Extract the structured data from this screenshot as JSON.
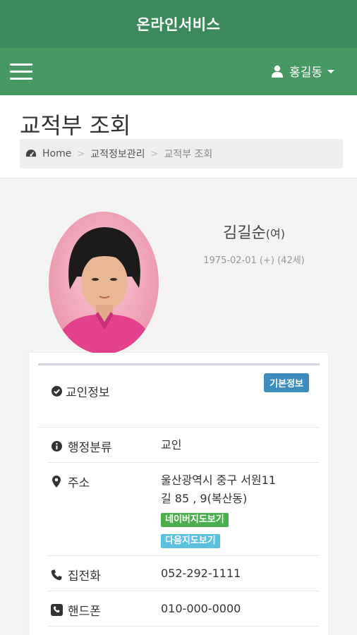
{
  "app": {
    "title": "온라인서비스"
  },
  "navbar": {
    "user_name": "홍길동"
  },
  "page": {
    "title": "교적부 조회",
    "breadcrumb": [
      "Home",
      "교적정보관리",
      "교적부 조회"
    ]
  },
  "profile": {
    "name": "김길순",
    "gender": "(여)",
    "birth": "1975-02-01 (+) (42세)"
  },
  "info_panel": {
    "title": "교인정보",
    "badge": "기본정보",
    "rows": {
      "category": {
        "label": "행정분류",
        "value": "교인"
      },
      "address": {
        "label": "주소",
        "line1": "울산광역시 중구 서원11",
        "line2": "길 85 , 9(복산동)",
        "naver_map": "네이버지도보기",
        "daum_map": "다음지도보기"
      },
      "home_phone": {
        "label": "집전화",
        "value": "052-292-1111"
      },
      "mobile": {
        "label": "핸드폰",
        "value": "010-000-0000"
      }
    }
  },
  "colors": {
    "header": "#3c8a5c",
    "navbar": "#489864",
    "badge": "#3c8dbc",
    "naver_button": "#4cae4c",
    "daum_button": "#5bc0de"
  },
  "icons": {
    "menu": "hamburger-icon",
    "user": "user-icon",
    "home": "dashboard-icon",
    "panel": "check-circle-icon",
    "category": "info-circle-icon",
    "address": "map-marker-icon",
    "home_phone": "phone-icon",
    "mobile": "phone-square-icon"
  }
}
